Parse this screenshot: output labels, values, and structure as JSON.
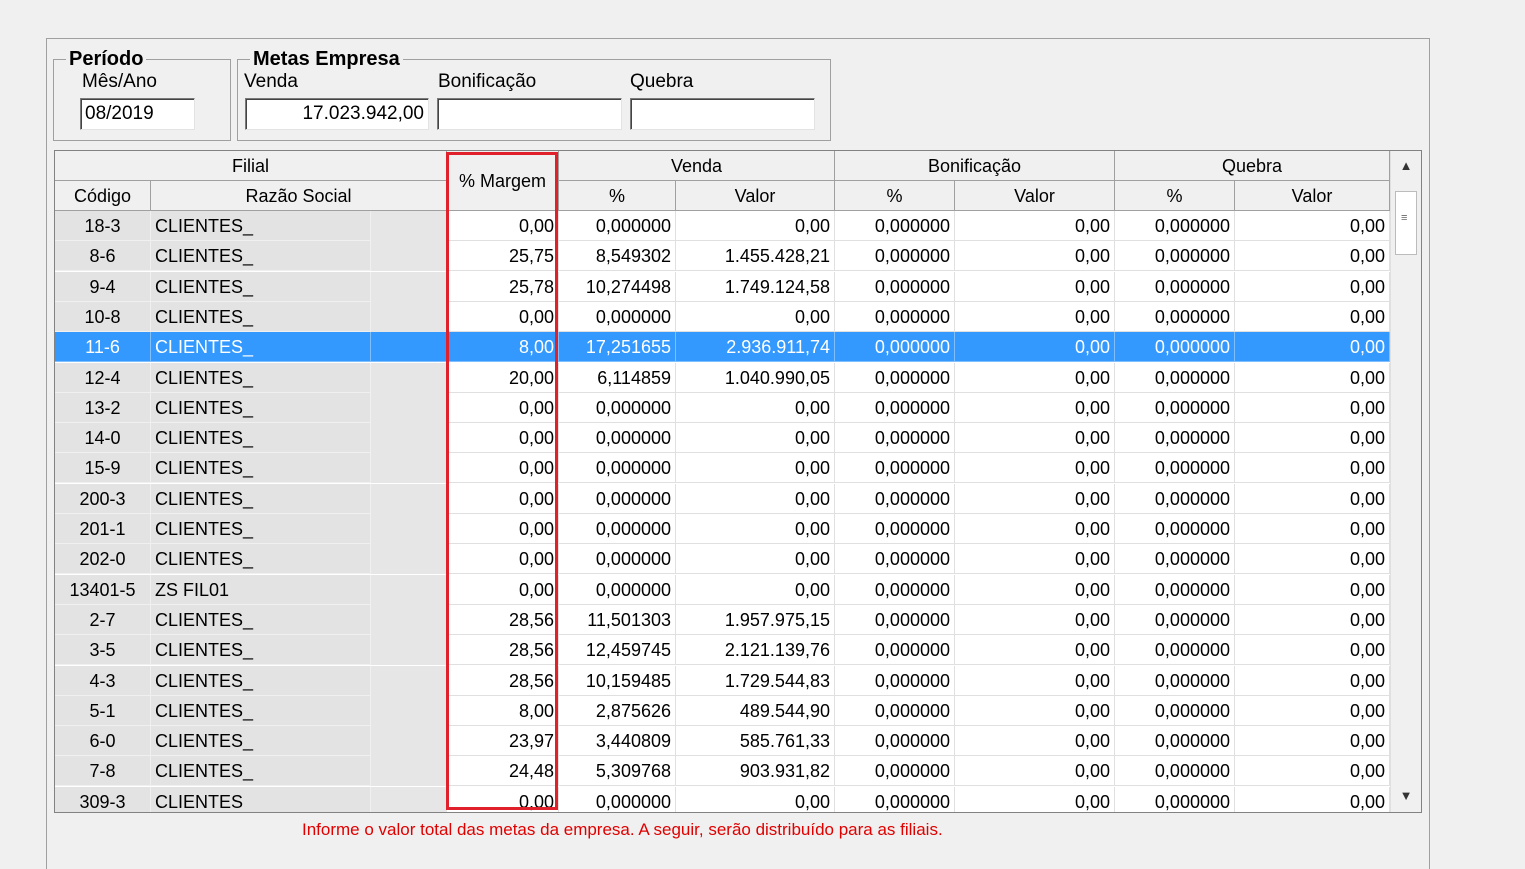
{
  "periodo": {
    "title": "Período",
    "mes_ano_label": "Mês/Ano",
    "mes_ano_value": "08/2019"
  },
  "metas": {
    "title": "Metas Empresa",
    "venda_label": "Venda",
    "venda_value": "17.023.942,00",
    "bonificacao_label": "Bonificação",
    "bonificacao_value": "",
    "quebra_label": "Quebra",
    "quebra_value": ""
  },
  "grid": {
    "group_headers": {
      "filial": "Filial",
      "margem": "% Margem",
      "venda": "Venda",
      "bonificacao": "Bonificação",
      "quebra": "Quebra"
    },
    "sub_headers": {
      "codigo": "Código",
      "razao": "Razão Social",
      "pct": "%",
      "valor": "Valor"
    },
    "selected_index": 4,
    "rows": [
      {
        "codigo": "18-3",
        "razao": "CLIENTES_",
        "margem": "0,00",
        "venda_pct": "0,000000",
        "venda_valor": "0,00",
        "bon_pct": "0,000000",
        "bon_valor": "0,00",
        "queb_pct": "0,000000",
        "queb_valor": "0,00"
      },
      {
        "codigo": "8-6",
        "razao": "CLIENTES_",
        "margem": "25,75",
        "venda_pct": "8,549302",
        "venda_valor": "1.455.428,21",
        "bon_pct": "0,000000",
        "bon_valor": "0,00",
        "queb_pct": "0,000000",
        "queb_valor": "0,00"
      },
      {
        "codigo": "9-4",
        "razao": "CLIENTES_",
        "margem": "25,78",
        "venda_pct": "10,274498",
        "venda_valor": "1.749.124,58",
        "bon_pct": "0,000000",
        "bon_valor": "0,00",
        "queb_pct": "0,000000",
        "queb_valor": "0,00"
      },
      {
        "codigo": "10-8",
        "razao": "CLIENTES_",
        "margem": "0,00",
        "venda_pct": "0,000000",
        "venda_valor": "0,00",
        "bon_pct": "0,000000",
        "bon_valor": "0,00",
        "queb_pct": "0,000000",
        "queb_valor": "0,00"
      },
      {
        "codigo": "11-6",
        "razao": "CLIENTES_",
        "margem": "8,00",
        "venda_pct": "17,251655",
        "venda_valor": "2.936.911,74",
        "bon_pct": "0,000000",
        "bon_valor": "0,00",
        "queb_pct": "0,000000",
        "queb_valor": "0,00"
      },
      {
        "codigo": "12-4",
        "razao": "CLIENTES_",
        "margem": "20,00",
        "venda_pct": "6,114859",
        "venda_valor": "1.040.990,05",
        "bon_pct": "0,000000",
        "bon_valor": "0,00",
        "queb_pct": "0,000000",
        "queb_valor": "0,00"
      },
      {
        "codigo": "13-2",
        "razao": "CLIENTES_",
        "margem": "0,00",
        "venda_pct": "0,000000",
        "venda_valor": "0,00",
        "bon_pct": "0,000000",
        "bon_valor": "0,00",
        "queb_pct": "0,000000",
        "queb_valor": "0,00"
      },
      {
        "codigo": "14-0",
        "razao": "CLIENTES_",
        "margem": "0,00",
        "venda_pct": "0,000000",
        "venda_valor": "0,00",
        "bon_pct": "0,000000",
        "bon_valor": "0,00",
        "queb_pct": "0,000000",
        "queb_valor": "0,00"
      },
      {
        "codigo": "15-9",
        "razao": "CLIENTES_",
        "margem": "0,00",
        "venda_pct": "0,000000",
        "venda_valor": "0,00",
        "bon_pct": "0,000000",
        "bon_valor": "0,00",
        "queb_pct": "0,000000",
        "queb_valor": "0,00"
      },
      {
        "codigo": "200-3",
        "razao": "CLIENTES_",
        "margem": "0,00",
        "venda_pct": "0,000000",
        "venda_valor": "0,00",
        "bon_pct": "0,000000",
        "bon_valor": "0,00",
        "queb_pct": "0,000000",
        "queb_valor": "0,00"
      },
      {
        "codigo": "201-1",
        "razao": "CLIENTES_",
        "margem": "0,00",
        "venda_pct": "0,000000",
        "venda_valor": "0,00",
        "bon_pct": "0,000000",
        "bon_valor": "0,00",
        "queb_pct": "0,000000",
        "queb_valor": "0,00"
      },
      {
        "codigo": "202-0",
        "razao": "CLIENTES_",
        "margem": "0,00",
        "venda_pct": "0,000000",
        "venda_valor": "0,00",
        "bon_pct": "0,000000",
        "bon_valor": "0,00",
        "queb_pct": "0,000000",
        "queb_valor": "0,00"
      },
      {
        "codigo": "13401-5",
        "razao": "ZS FIL01",
        "margem": "0,00",
        "venda_pct": "0,000000",
        "venda_valor": "0,00",
        "bon_pct": "0,000000",
        "bon_valor": "0,00",
        "queb_pct": "0,000000",
        "queb_valor": "0,00"
      },
      {
        "codigo": "2-7",
        "razao": "CLIENTES_",
        "margem": "28,56",
        "venda_pct": "11,501303",
        "venda_valor": "1.957.975,15",
        "bon_pct": "0,000000",
        "bon_valor": "0,00",
        "queb_pct": "0,000000",
        "queb_valor": "0,00"
      },
      {
        "codigo": "3-5",
        "razao": "CLIENTES_",
        "margem": "28,56",
        "venda_pct": "12,459745",
        "venda_valor": "2.121.139,76",
        "bon_pct": "0,000000",
        "bon_valor": "0,00",
        "queb_pct": "0,000000",
        "queb_valor": "0,00"
      },
      {
        "codigo": "4-3",
        "razao": "CLIENTES_",
        "margem": "28,56",
        "venda_pct": "10,159485",
        "venda_valor": "1.729.544,83",
        "bon_pct": "0,000000",
        "bon_valor": "0,00",
        "queb_pct": "0,000000",
        "queb_valor": "0,00"
      },
      {
        "codigo": "5-1",
        "razao": "CLIENTES_",
        "margem": "8,00",
        "venda_pct": "2,875626",
        "venda_valor": "489.544,90",
        "bon_pct": "0,000000",
        "bon_valor": "0,00",
        "queb_pct": "0,000000",
        "queb_valor": "0,00"
      },
      {
        "codigo": "6-0",
        "razao": "CLIENTES_",
        "margem": "23,97",
        "venda_pct": "3,440809",
        "venda_valor": "585.761,33",
        "bon_pct": "0,000000",
        "bon_valor": "0,00",
        "queb_pct": "0,000000",
        "queb_valor": "0,00"
      },
      {
        "codigo": "7-8",
        "razao": "CLIENTES_",
        "margem": "24,48",
        "venda_pct": "5,309768",
        "venda_valor": "903.931,82",
        "bon_pct": "0,000000",
        "bon_valor": "0,00",
        "queb_pct": "0,000000",
        "queb_valor": "0,00"
      },
      {
        "codigo": "309-3",
        "razao": "CLIENTES",
        "margem": "0,00",
        "venda_pct": "0,000000",
        "venda_valor": "0,00",
        "bon_pct": "0,000000",
        "bon_valor": "0,00",
        "queb_pct": "0,000000",
        "queb_valor": "0,00"
      }
    ]
  },
  "hint": "Informe o valor total das metas da empresa. A seguir, serão distribuído para as filiais.",
  "colors": {
    "selection": "#3399ff",
    "highlight_border": "#e0202a",
    "hint_text": "#e00000"
  },
  "icons": {
    "scroll_up": "scroll-up-arrow-icon",
    "scroll_down": "scroll-down-arrow-icon",
    "thumb_grip": "scroll-grip-icon"
  }
}
